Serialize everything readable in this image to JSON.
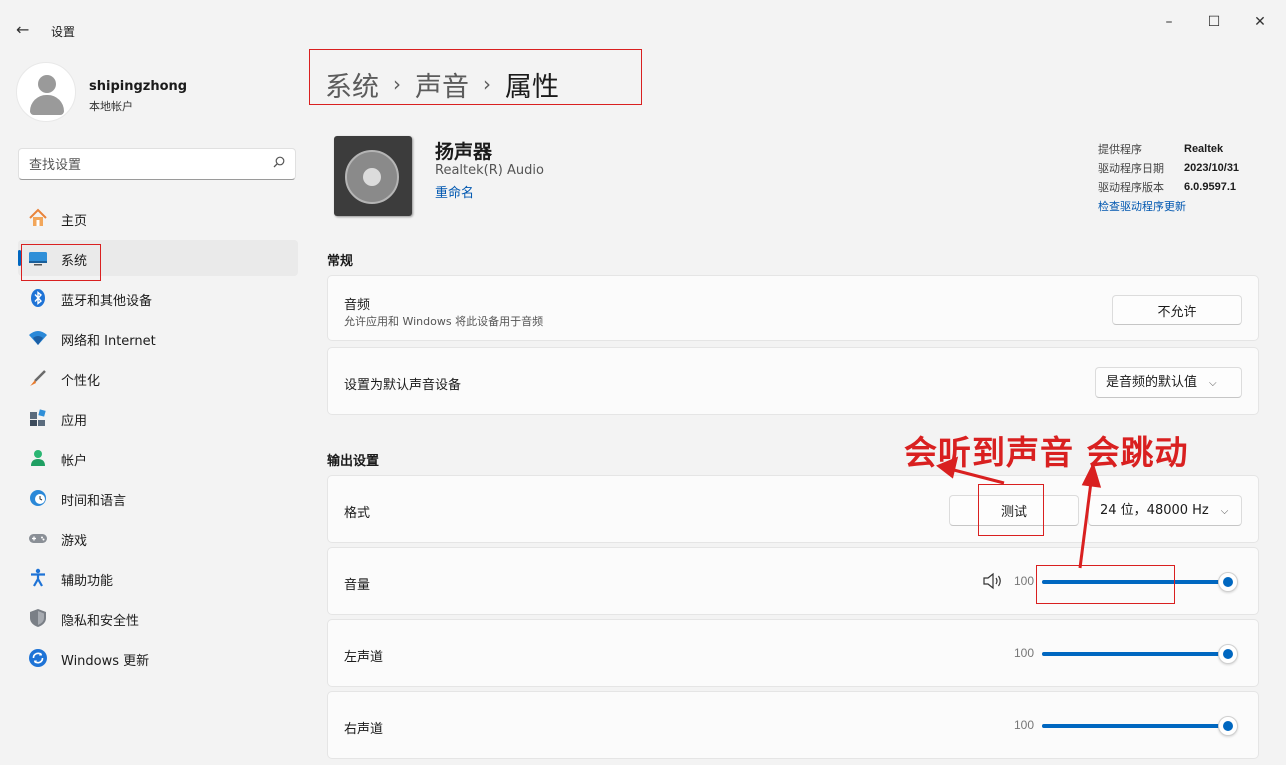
{
  "window": {
    "title": "设置",
    "back": "←",
    "minimize": "–",
    "maximize": "☐",
    "close": "✕"
  },
  "profile": {
    "name": "shipingzhong",
    "account_type": "本地帐户"
  },
  "search": {
    "placeholder": "查找设置"
  },
  "sidebar": {
    "items": [
      {
        "label": "主页",
        "icon": "home-icon"
      },
      {
        "label": "系统",
        "icon": "system-icon",
        "active": true
      },
      {
        "label": "蓝牙和其他设备",
        "icon": "bluetooth-icon"
      },
      {
        "label": "网络和 Internet",
        "icon": "wifi-icon"
      },
      {
        "label": "个性化",
        "icon": "brush-icon"
      },
      {
        "label": "应用",
        "icon": "apps-icon"
      },
      {
        "label": "帐户",
        "icon": "account-icon"
      },
      {
        "label": "时间和语言",
        "icon": "globe-clock-icon"
      },
      {
        "label": "游戏",
        "icon": "gamepad-icon"
      },
      {
        "label": "辅助功能",
        "icon": "accessibility-icon"
      },
      {
        "label": "隐私和安全性",
        "icon": "shield-icon"
      },
      {
        "label": "Windows 更新",
        "icon": "update-icon"
      }
    ]
  },
  "breadcrumb": {
    "level1": "系统",
    "level2": "声音",
    "current": "属性",
    "separator": "›"
  },
  "device": {
    "name": "扬声器",
    "subtitle": "Realtek(R) Audio",
    "rename": "重命名"
  },
  "driver": {
    "provider_label": "提供程序",
    "provider": "Realtek",
    "date_label": "驱动程序日期",
    "date": "2023/10/31",
    "version_label": "驱动程序版本",
    "version": "6.0.9597.1",
    "check_update": "检查驱动程序更新"
  },
  "general": {
    "title": "常规",
    "audio_label": "音频",
    "audio_desc": "允许应用和 Windows 将此设备用于音频",
    "audio_button": "不允许",
    "default_label": "设置为默认声音设备",
    "default_value": "是音频的默认值"
  },
  "output": {
    "title": "输出设置",
    "format_label": "格式",
    "test_button": "测试",
    "format_value": "24 位，48000 Hz",
    "volume_label": "音量",
    "volume_value": "100",
    "left_label": "左声道",
    "left_value": "100",
    "right_label": "右声道",
    "right_value": "100",
    "volume_level_percent": 100,
    "left_level_percent": 100,
    "right_level_percent": 100
  },
  "annotation": {
    "text": "会听到声音 会跳动",
    "color": "#d92020"
  },
  "colors": {
    "accent": "#0067c0",
    "link": "#0057b0",
    "annotation_red": "#d92020"
  }
}
